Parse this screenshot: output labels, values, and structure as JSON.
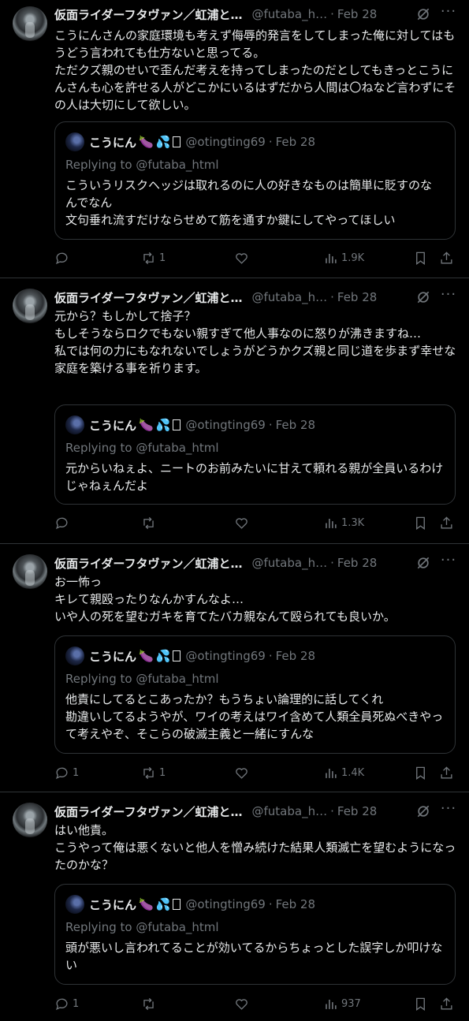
{
  "tweets": [
    {
      "author_name": "仮面ライダーフタヴァン／虹浦と…",
      "author_handle": "@futaba_h…",
      "separator": "·",
      "date": "Feb 28",
      "text": "こうにんさんの家庭環境も考えず侮辱的発言をしてしまった俺に対してはもうどう言われても仕方ないと思ってる。\nただクズ親のせいで歪んだ考えを持ってしまったのだとしてもきっとこうにんさんも心を許せる人がどこかにいるはずだから人間は〇ねなど言わずにその人は大切にして欲しい。",
      "quote": {
        "name": "こうにん",
        "handle": "@otingting69",
        "date": "Feb 28",
        "replying_to": "Replying to @futaba_html",
        "text": "こういうリスクヘッジは取れるのに人の好きなものは簡単に貶すのなんでなん\n文句垂れ流すだけならせめて筋を通すか鍵にしてやってほしい"
      },
      "replies": "",
      "reposts": "1",
      "views": "1.9K"
    },
    {
      "author_name": "仮面ライダーフタヴァン／虹浦と…",
      "author_handle": "@futaba_h…",
      "separator": "·",
      "date": "Feb 28",
      "text": "元から？もしかして捨子？\nもしそうならロクでもない親すぎて他人事なのに怒りが沸きますね…\n私では何の力にもなれないでしょうがどうかクズ親と同じ道を歩まず幸せな家庭を築ける事を祈ります。",
      "quote": {
        "name": "こうにん",
        "handle": "@otingting69",
        "date": "Feb 28",
        "replying_to": "Replying to @futaba_html",
        "text": "元からいねぇよ、ニートのお前みたいに甘えて頼れる親が全員いるわけじゃねぇんだよ"
      },
      "replies": "",
      "reposts": "",
      "views": "1.3K"
    },
    {
      "author_name": "仮面ライダーフタヴァン／虹浦と…",
      "author_handle": "@futaba_h…",
      "separator": "·",
      "date": "Feb 28",
      "text": "お一怖っ\nキレて親殴ったりなんかすんなよ…\nいや人の死を望むガキを育てたバカ親なんて殴られても良いか。",
      "quote": {
        "name": "こうにん",
        "handle": "@otingting69",
        "date": "Feb 28",
        "replying_to": "Replying to @futaba_html",
        "text": "他責にしてるとこあったか？もうちょい論理的に話してくれ\n勘違いしてるようやが、ワイの考えはワイ含めて人類全員死ぬべきやって考えやぞ、そこらの破滅主義と一緒にすんな"
      },
      "replies": "1",
      "reposts": "1",
      "views": "1.4K"
    },
    {
      "author_name": "仮面ライダーフタヴァン／虹浦と…",
      "author_handle": "@futaba_h…",
      "separator": "·",
      "date": "Feb 28",
      "text": "はい他責。\nこうやって俺は悪くないと他人を憎み続けた結果人類滅亡を望むようになったのかな？",
      "quote": {
        "name": "こうにん",
        "handle": "@otingting69",
        "date": "Feb 28",
        "replying_to": "Replying to @futaba_html",
        "text": "頭が悪いし言われてることが効いてるからちょっとした誤字しか叩けない"
      },
      "replies": "1",
      "reposts": "",
      "views": "937"
    }
  ],
  "icons": {
    "more": "···",
    "eggplant": "🍆",
    "sweat": "💦"
  },
  "colors": {
    "background": "#000000",
    "text": "#e7e9ea",
    "muted": "#71767b",
    "border": "#2f3336"
  }
}
